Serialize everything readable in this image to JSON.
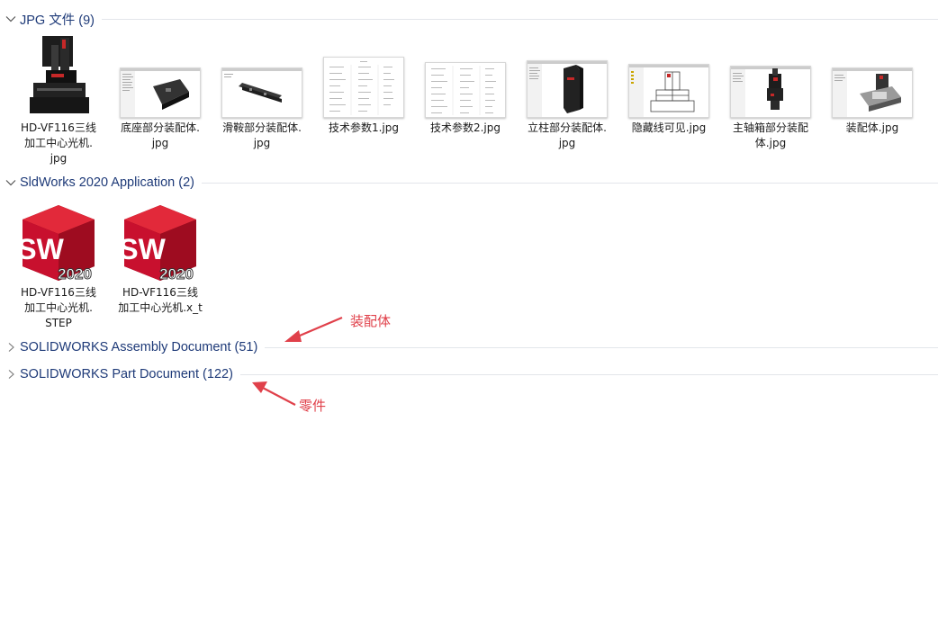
{
  "groups": {
    "jpg": {
      "title": "JPG 文件 (9)",
      "expanded": true
    },
    "sldworks": {
      "title": "SldWorks 2020 Application (2)",
      "expanded": true
    },
    "assembly": {
      "title": "SOLIDWORKS Assembly Document (51)",
      "expanded": false
    },
    "part": {
      "title": "SOLIDWORKS Part Document (122)",
      "expanded": false
    }
  },
  "jpg_files": [
    {
      "name": "HD-VF116三线加工中心光机.jpg",
      "line1": "HD-VF116三线",
      "line2": "加工中心光机.",
      "line3": "jpg",
      "thumb": "machine-photo"
    },
    {
      "name": "底座部分装配体.jpg",
      "line1": "底座部分装配体.",
      "line2": "jpg",
      "line3": "",
      "thumb": "cad-window"
    },
    {
      "name": "滑鞍部分装配体.jpg",
      "line1": "滑鞍部分装配体.",
      "line2": "jpg",
      "line3": "",
      "thumb": "cad-window"
    },
    {
      "name": "技术参数1.jpg",
      "line1": "技术参数1.jpg",
      "line2": "",
      "line3": "",
      "thumb": "table-doc"
    },
    {
      "name": "技术参数2.jpg",
      "line1": "技术参数2.jpg",
      "line2": "",
      "line3": "",
      "thumb": "table-doc"
    },
    {
      "name": "立柱部分装配体.jpg",
      "line1": "立柱部分装配体.",
      "line2": "jpg",
      "line3": "",
      "thumb": "cad-window"
    },
    {
      "name": "隐藏线可见.jpg",
      "line1": "隐藏线可见.jpg",
      "line2": "",
      "line3": "",
      "thumb": "cad-window"
    },
    {
      "name": "主轴箱部分装配体.jpg",
      "line1": "主轴箱部分装配",
      "line2": "体.jpg",
      "line3": "",
      "thumb": "cad-window"
    },
    {
      "name": "装配体.jpg",
      "line1": "装配体.jpg",
      "line2": "",
      "line3": "",
      "thumb": "cad-window"
    }
  ],
  "sw_files": [
    {
      "name": "HD-VF116三线加工中心光机.STEP",
      "line1": "HD-VF116三线",
      "line2": "加工中心光机.",
      "line3": "STEP",
      "icon_text": "SW",
      "badge": "2020"
    },
    {
      "name": "HD-VF116三线加工中心光机.x_t",
      "line1": "HD-VF116三线",
      "line2": "加工中心光机.x_t",
      "line3": "",
      "icon_text": "SW",
      "badge": "2020"
    }
  ],
  "annotations": {
    "assembly": "装配体",
    "part": "零件",
    "color": "#e0404a"
  },
  "colors": {
    "group_title": "#1e3a78",
    "sw_red": "#c8102e"
  }
}
